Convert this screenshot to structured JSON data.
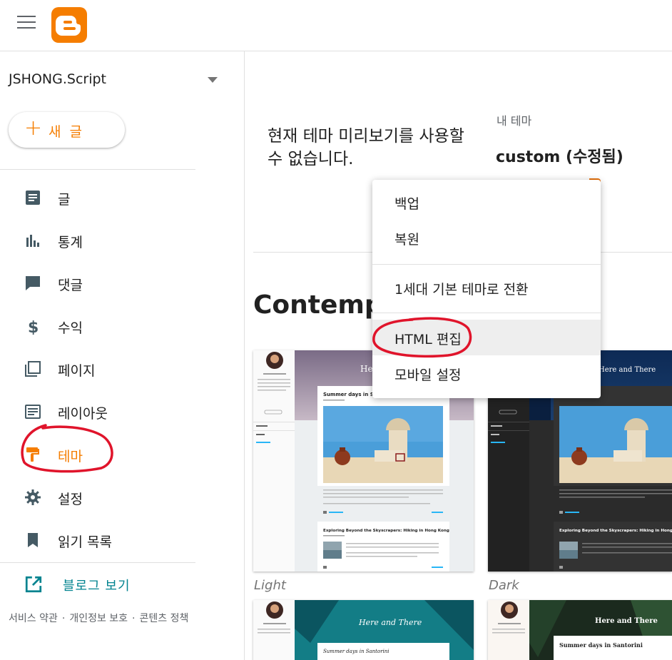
{
  "header": {
    "menu_icon": "hamburger-menu-icon",
    "logo": "blogger-logo"
  },
  "sidebar": {
    "blog_name": "JSHONG.Script",
    "new_post": {
      "plus": "+",
      "label": "새 글"
    },
    "items": [
      {
        "label": "글",
        "icon": "posts-icon"
      },
      {
        "label": "통계",
        "icon": "stats-icon"
      },
      {
        "label": "댓글",
        "icon": "comments-icon"
      },
      {
        "label": "수익",
        "icon": "dollar-icon"
      },
      {
        "label": "페이지",
        "icon": "pages-icon"
      },
      {
        "label": "레이아웃",
        "icon": "layout-icon"
      },
      {
        "label": "테마",
        "icon": "paint-roller-icon",
        "active": true
      },
      {
        "label": "설정",
        "icon": "gear-icon"
      },
      {
        "label": "읽기 목록",
        "icon": "bookmark-icon"
      }
    ],
    "view_blog": "블로그 보기",
    "footer": {
      "terms": "서비스 약관",
      "privacy": "개인정보 보호",
      "content_policy": "콘텐츠 정책",
      "separator": "·"
    }
  },
  "main": {
    "preview_message": "현재 테마 미리보기를 사용할 수 없습니다.",
    "my_theme_label": "내 테마",
    "my_theme_name": "custom (수정됨)",
    "section_title": "Contempo",
    "themes": [
      {
        "name": "Light"
      },
      {
        "name": "Dark"
      }
    ],
    "preview_text": {
      "header_title": "Here and There",
      "post1_title": "Summer days in Santorini",
      "post2_title": "Exploring Beyond the Skyscrapers: Hiking in Hong Kong"
    }
  },
  "menu": {
    "items": [
      {
        "label": "백업"
      },
      {
        "label": "복원"
      },
      {
        "label": "1세대 기본 테마로 전환"
      },
      {
        "label": "HTML 편집",
        "highlighted": true
      },
      {
        "label": "모바일 설정"
      }
    ]
  },
  "colors": {
    "accent": "#f57d00",
    "link": "#00838f",
    "annotation": "#e0142b"
  }
}
